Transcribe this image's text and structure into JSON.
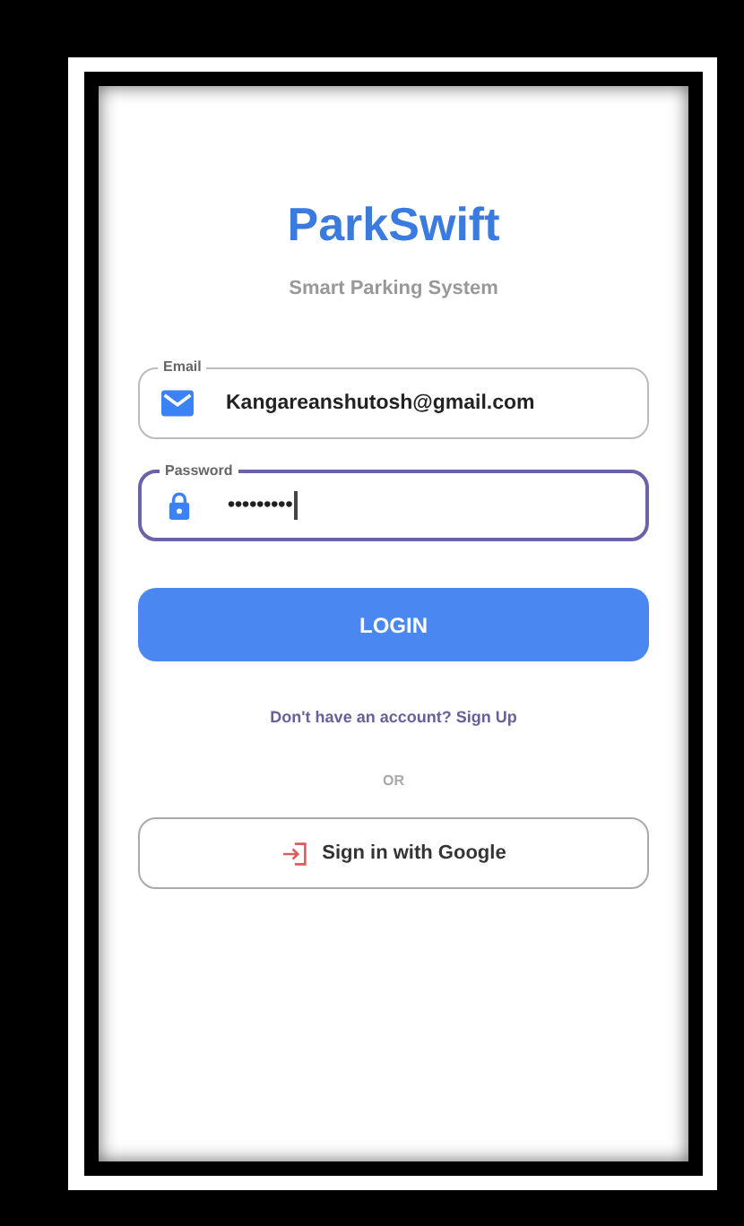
{
  "app": {
    "title": "ParkSwift",
    "subtitle": "Smart Parking System"
  },
  "fields": [
    {
      "kind": "email",
      "label": "Email",
      "value": "Kangareanshutosh@gmail.com",
      "focused": false
    },
    {
      "kind": "password",
      "label": "Password",
      "value": "•••••••••",
      "focused": true
    }
  ],
  "login_button": "LOGIN",
  "signup_link": "Don't have an account? Sign Up",
  "divider": "OR",
  "google_button": "Sign in with Google"
}
